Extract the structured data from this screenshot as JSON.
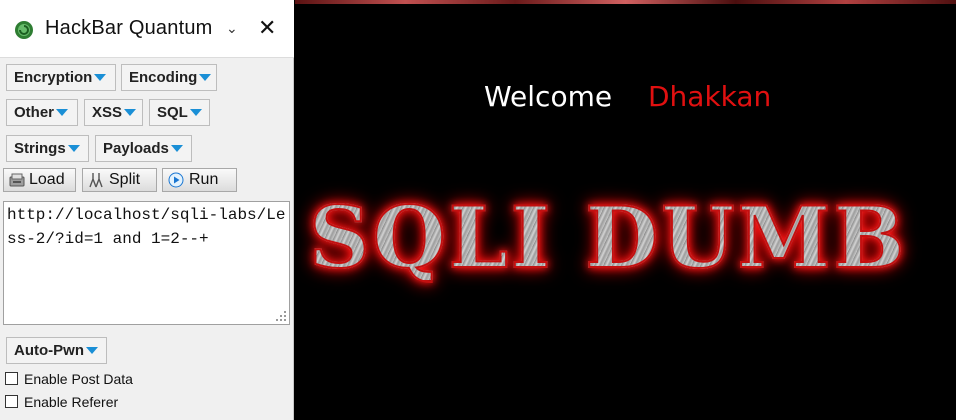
{
  "sidebar": {
    "title": "HackBar Quantum",
    "menus": {
      "encryption": "Encryption",
      "encoding": "Encoding",
      "other": "Other",
      "xss": "XSS",
      "sql": "SQL",
      "strings": "Strings",
      "payloads": "Payloads",
      "auto_pwn": "Auto-Pwn"
    },
    "tools": {
      "load": "Load",
      "split": "Split",
      "run": "Run"
    },
    "url_value": "http://localhost/sqli-labs/Less-2/?id=1 and 1=2--+",
    "checkboxes": {
      "post_data": "Enable Post Data",
      "referer": "Enable Referer"
    },
    "icons": {
      "logo": "hackbar-logo-icon",
      "chevron": "chevron-down-icon",
      "close": "close-icon",
      "load": "load-icon",
      "split": "split-icon",
      "run": "run-icon"
    }
  },
  "page": {
    "welcome": "Welcome",
    "user": "Dhakkan",
    "banner": "SQLI DUMB",
    "colors": {
      "user": "#e01010",
      "banner_glow": "#ff1a1a",
      "menu_arrow": "#1a8fd6"
    }
  }
}
